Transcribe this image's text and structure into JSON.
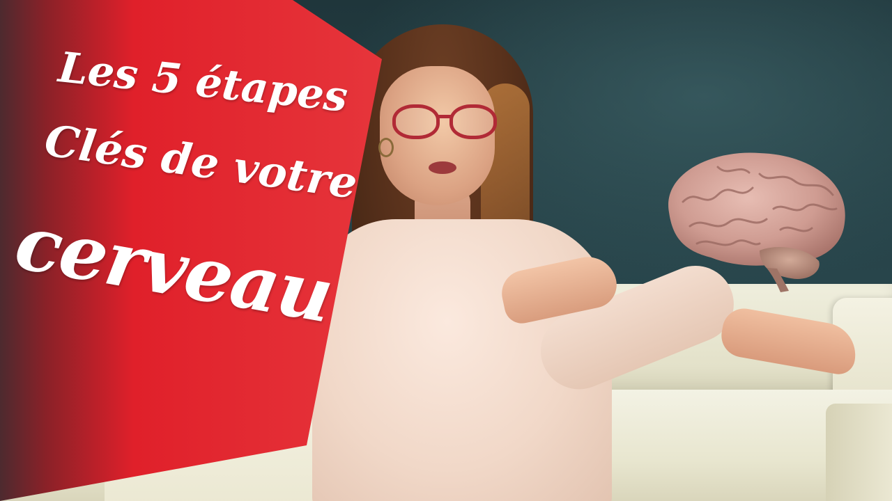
{
  "thumbnail": {
    "title_lines": [
      "Les 5 étapes",
      "Clés de votre",
      "cerveau"
    ]
  },
  "colors": {
    "banner_red": "#e3232b",
    "banner_dark": "#5a2a2e",
    "wall": "#28454b",
    "sofa": "#ebe8d2",
    "sweater": "#f6e2d5",
    "glasses": "#b12a36",
    "brain": "#d3a49c"
  }
}
